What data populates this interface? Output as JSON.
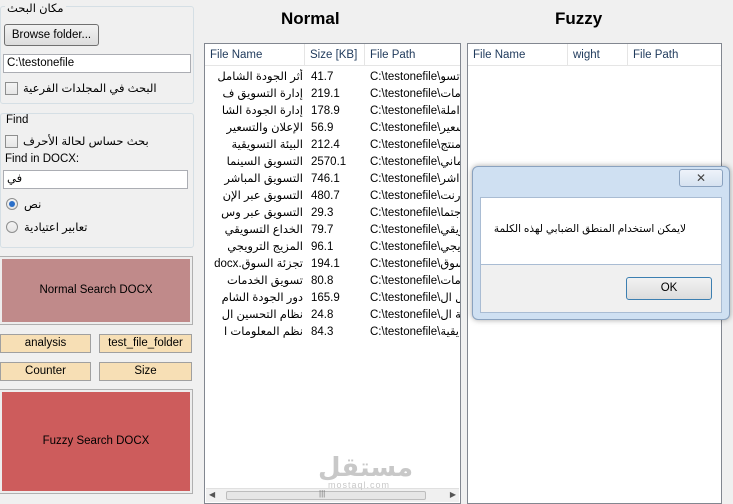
{
  "left_panel": {
    "search_location": {
      "title": "مكان البحث",
      "browse_button": "Browse folder...",
      "folder_value": "C:\\testonefile",
      "subfolders_label": "البحث في المجلدات الفرعية"
    },
    "find": {
      "title": "Find",
      "case_sensitive_label": "بحث حساس لحالة الأحرف",
      "find_in_label": "Find in DOCX:",
      "find_value": "في",
      "radio_text_label": "نص",
      "radio_regex_label": "تعابير اعتيادية"
    },
    "normal_search_button": "Normal Search DOCX",
    "buttons": {
      "analysis": "analysis",
      "test_file_folder": "test_file_folder",
      "counter": "Counter",
      "size": "Size"
    },
    "fuzzy_search_button": "Fuzzy Search  DOCX"
  },
  "normal": {
    "title": "Normal",
    "columns": [
      "File Name",
      "Size [KB]",
      "File Path"
    ],
    "rows": [
      [
        "أثر الجودة الشامل",
        "41.7",
        "C:\\testonefile\\تسو"
      ],
      [
        "إدارة التسويق ف",
        "219.1",
        "C:\\testonefile\\مات"
      ],
      [
        "إدارة الجودة الشا",
        "178.9",
        "C:\\testonefile\\املة"
      ],
      [
        "الإعلان والتسعير",
        "56.9",
        "C:\\testonefile\\سعير"
      ],
      [
        "البيئة التسويقية",
        "212.4",
        "C:\\testonefile\\منتج"
      ],
      [
        "التسويق السينما",
        "2570.1",
        "C:\\testonefile\\ماني"
      ],
      [
        "التسويق المباشر",
        "746.1",
        "C:\\testonefile\\اشر"
      ],
      [
        "التسويق عبر الإن",
        "480.7",
        "C:\\testonefile\\رنت"
      ],
      [
        "التسويق عبر وس",
        "29.3",
        "C:\\testonefile\\جتما"
      ],
      [
        "الخداع التسويقي",
        "79.7",
        "C:\\testonefile\\ويقي"
      ],
      [
        "المزيج الترويجي",
        "96.1",
        "C:\\testonefile\\يجي"
      ],
      [
        "تجزئة السوق.docx",
        "194.1",
        "C:\\testonefile\\سوق"
      ],
      [
        "تسويق الخدمات",
        "80.8",
        "C:\\testonefile\\مات"
      ],
      [
        "دور الجودة الشام",
        "165.9",
        "C:\\testonefile\\ل ال"
      ],
      [
        "نظام التحسين ال",
        "24.8",
        "C:\\testonefile\\ية ال"
      ],
      [
        "نظم المعلومات ا",
        "84.3",
        "C:\\testonefile\\يقية"
      ]
    ]
  },
  "fuzzy": {
    "title": "Fuzzy",
    "columns": [
      "File Name",
      "wight",
      "File Path"
    ]
  },
  "dialog": {
    "close_glyph": "✕",
    "message": "لايمكن استخدام المنطق الضبابي لهذه الكلمة",
    "ok_button": "OK"
  },
  "watermark": {
    "text": "مستقل",
    "sub": "mostaql.com"
  },
  "colors": {
    "normal_search_bg": "#c08a8a",
    "fuzzy_search_bg": "#cd5c5c",
    "beige_button_bg": "#f7dfb5"
  }
}
